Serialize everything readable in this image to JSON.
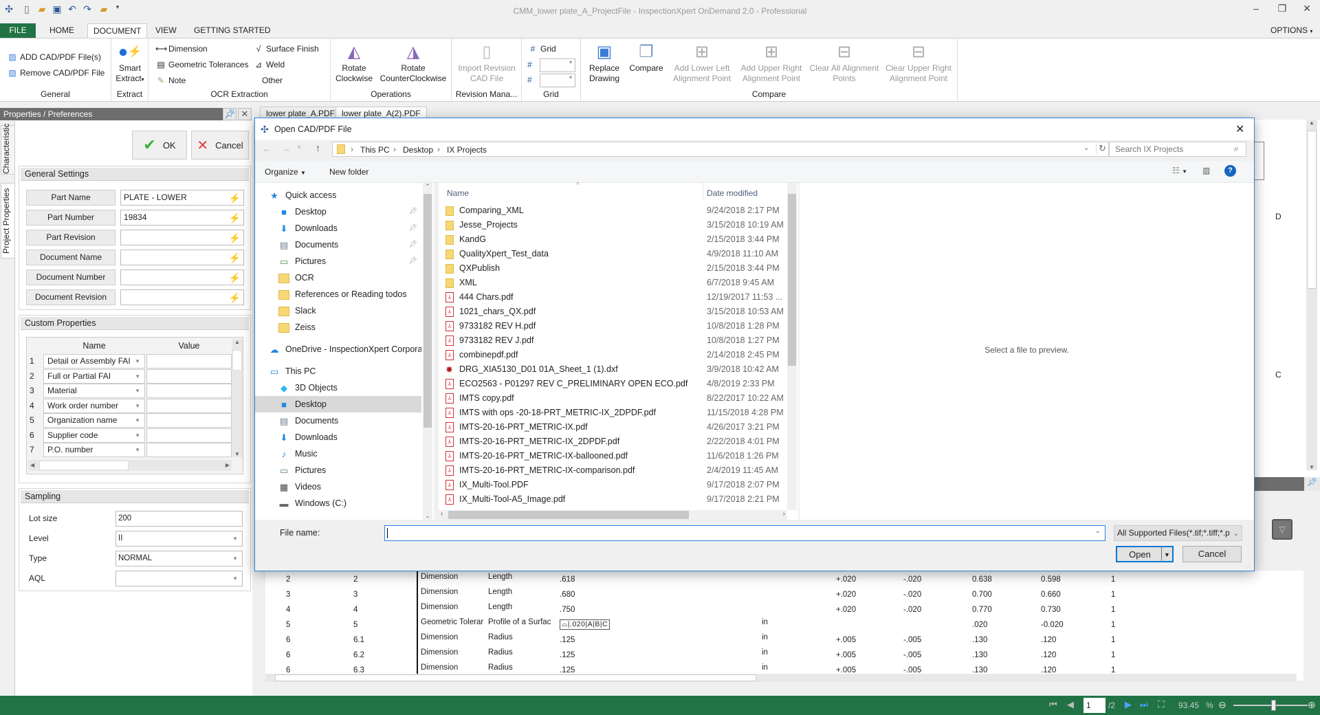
{
  "app": {
    "title": "CMM_lower plate_A_ProjectFile - InspectionXpert OnDemand 2.0 - Professional",
    "options_label": "OPTIONS"
  },
  "ribbon_tabs": [
    "FILE",
    "HOME",
    "DOCUMENT",
    "VIEW",
    "GETTING STARTED"
  ],
  "ribbon": {
    "general": {
      "add": "ADD CAD/PDF File(s)",
      "remove": "Remove CAD/PDF File",
      "label": "General"
    },
    "extract": {
      "smart_1": "Smart",
      "smart_2": "Extract",
      "label": "Extract"
    },
    "ocr": {
      "dimension": "Dimension",
      "geo": "Geometric Tolerances",
      "note": "Note",
      "surface": "Surface Finish",
      "weld": "Weld",
      "other": "Other",
      "label": "OCR Extraction"
    },
    "operations": {
      "cw_1": "Rotate",
      "cw_2": "Clockwise",
      "ccw_1": "Rotate",
      "ccw_2": "CounterClockwise",
      "label": "Operations"
    },
    "revision": {
      "import_1": "Import Revision",
      "import_2": "CAD File",
      "label": "Revision Mana..."
    },
    "grid": {
      "grid": "Grid",
      "label": "Grid"
    },
    "compare": {
      "replace_1": "Replace",
      "replace_2": "Drawing",
      "compare": "Compare",
      "lower_left_1": "Add Lower Left",
      "lower_left_2": "Alignment Point",
      "upper_right_1": "Add Upper Right",
      "upper_right_2": "Alignment Point",
      "clear_all_1": "Clear All Alignment",
      "clear_all_2": "Points",
      "clear_ur_1": "Clear Upper Right",
      "clear_ur_2": "Alignment Point",
      "label": "Compare"
    }
  },
  "left_panel": {
    "title": "Properties / Preferences",
    "vtabs": [
      "Characteristic",
      "Project Properties"
    ],
    "ok": "OK",
    "cancel": "Cancel",
    "general_settings": {
      "title": "General Settings",
      "fields": [
        {
          "label": "Part Name",
          "value": "PLATE - LOWER"
        },
        {
          "label": "Part Number",
          "value": "19834"
        },
        {
          "label": "Part Revision",
          "value": ""
        },
        {
          "label": "Document Name",
          "value": ""
        },
        {
          "label": "Document Number",
          "value": ""
        },
        {
          "label": "Document Revision",
          "value": ""
        }
      ]
    },
    "custom_properties": {
      "title": "Custom Properties",
      "headers": [
        "Name",
        "Value"
      ],
      "rows": [
        {
          "n": "1",
          "name": "Detail or Assembly FAI",
          "value": ""
        },
        {
          "n": "2",
          "name": "Full or Partial FAI",
          "value": ""
        },
        {
          "n": "3",
          "name": "Material",
          "value": ""
        },
        {
          "n": "4",
          "name": "Work order number",
          "value": ""
        },
        {
          "n": "5",
          "name": "Organization name",
          "value": ""
        },
        {
          "n": "6",
          "name": "Supplier code",
          "value": ""
        },
        {
          "n": "7",
          "name": "P.O. number",
          "value": ""
        }
      ]
    },
    "sampling": {
      "title": "Sampling",
      "fields": [
        {
          "label": "Lot size",
          "value": "200",
          "dropdown": false
        },
        {
          "label": "Level",
          "value": "II",
          "dropdown": true
        },
        {
          "label": "Type",
          "value": "NORMAL",
          "dropdown": true
        },
        {
          "label": "AQL",
          "value": "",
          "dropdown": true
        }
      ]
    }
  },
  "doc_tabs": [
    "lower plate_A.PDF",
    "lower plate_A(2).PDF"
  ],
  "drawing_labels": [
    "D",
    "C"
  ],
  "dialog": {
    "title": "Open CAD/PDF File",
    "breadcrumb": [
      "This PC",
      "Desktop",
      "IX Projects"
    ],
    "search_placeholder": "Search IX Projects",
    "organize": "Organize",
    "new_folder": "New folder",
    "col_name": "Name",
    "col_date": "Date modified",
    "preview_text": "Select a file to preview.",
    "file_name_label": "File name:",
    "file_name_value": "",
    "file_type": "All Supported Files(*.tif;*.tiff;*.p",
    "open": "Open",
    "cancel": "Cancel",
    "nav": [
      {
        "label": "Quick access",
        "icon": "star",
        "level": 0
      },
      {
        "label": "Desktop",
        "icon": "desktop",
        "level": 1,
        "pinned": true
      },
      {
        "label": "Downloads",
        "icon": "download",
        "level": 1,
        "pinned": true
      },
      {
        "label": "Documents",
        "icon": "documents",
        "level": 1,
        "pinned": true
      },
      {
        "label": "Pictures",
        "icon": "pictures",
        "level": 1,
        "pinned": true
      },
      {
        "label": "OCR",
        "icon": "folder",
        "level": 1
      },
      {
        "label": "References or Reading todos",
        "icon": "folder",
        "level": 1
      },
      {
        "label": "Slack",
        "icon": "folder",
        "level": 1
      },
      {
        "label": "Zeiss",
        "icon": "folder",
        "level": 1
      },
      {
        "label": "OneDrive - InspectionXpert Corporatio",
        "icon": "cloud",
        "level": 0
      },
      {
        "label": "This PC",
        "icon": "computer",
        "level": 0
      },
      {
        "label": "3D Objects",
        "icon": "cube",
        "level": 1
      },
      {
        "label": "Desktop",
        "icon": "desktop",
        "level": 1,
        "selected": true
      },
      {
        "label": "Documents",
        "icon": "documents",
        "level": 1
      },
      {
        "label": "Downloads",
        "icon": "download",
        "level": 1
      },
      {
        "label": "Music",
        "icon": "music",
        "level": 1
      },
      {
        "label": "Pictures",
        "icon": "pictures",
        "level": 1
      },
      {
        "label": "Videos",
        "icon": "videos",
        "level": 1
      },
      {
        "label": "Windows (C:)",
        "icon": "drive",
        "level": 1
      }
    ],
    "files": [
      {
        "name": "Comparing_XML",
        "date": "9/24/2018 2:17 PM",
        "type": "folder"
      },
      {
        "name": "Jesse_Projects",
        "date": "3/15/2018 10:19 AM",
        "type": "folder"
      },
      {
        "name": "KandG",
        "date": "2/15/2018 3:44 PM",
        "type": "folder"
      },
      {
        "name": "QualityXpert_Test_data",
        "date": "4/9/2018 11:10 AM",
        "type": "folder"
      },
      {
        "name": "QXPublish",
        "date": "2/15/2018 3:44 PM",
        "type": "folder"
      },
      {
        "name": "XML",
        "date": "6/7/2018 9:45 AM",
        "type": "folder"
      },
      {
        "name": "444 Chars.pdf",
        "date": "12/19/2017 11:53 ...",
        "type": "pdf"
      },
      {
        "name": "1021_chars_QX.pdf",
        "date": "3/15/2018 10:53 AM",
        "type": "pdf"
      },
      {
        "name": "9733182 REV H.pdf",
        "date": "10/8/2018 1:28 PM",
        "type": "pdf"
      },
      {
        "name": "9733182 REV J.pdf",
        "date": "10/8/2018 1:27 PM",
        "type": "pdf"
      },
      {
        "name": "combinepdf.pdf",
        "date": "2/14/2018 2:45 PM",
        "type": "pdf"
      },
      {
        "name": "DRG_XIA5130_D01 01A_Sheet_1 (1).dxf",
        "date": "3/9/2018 10:42 AM",
        "type": "dxf"
      },
      {
        "name": "ECO2563 - P01297 REV C_PRELIMINARY OPEN ECO.pdf",
        "date": "4/8/2019 2:33 PM",
        "type": "pdf"
      },
      {
        "name": "IMTS copy.pdf",
        "date": "8/22/2017 10:22 AM",
        "type": "pdf"
      },
      {
        "name": "IMTS with ops -20-18-PRT_METRIC-IX_2DPDF.pdf",
        "date": "11/15/2018 4:28 PM",
        "type": "pdf"
      },
      {
        "name": "IMTS-20-16-PRT_METRIC-IX.pdf",
        "date": "4/26/2017 3:21 PM",
        "type": "pdf"
      },
      {
        "name": "IMTS-20-16-PRT_METRIC-IX_2DPDF.pdf",
        "date": "2/22/2018 4:01 PM",
        "type": "pdf"
      },
      {
        "name": "IMTS-20-16-PRT_METRIC-IX-ballooned.pdf",
        "date": "11/6/2018 1:26 PM",
        "type": "pdf"
      },
      {
        "name": "IMTS-20-16-PRT_METRIC-IX-comparison.pdf",
        "date": "2/4/2019 11:45 AM",
        "type": "pdf"
      },
      {
        "name": "IX_Multi-Tool.PDF",
        "date": "9/17/2018 2:07 PM",
        "type": "pdf"
      },
      {
        "name": "IX_Multi-Tool-A5_Image.pdf",
        "date": "9/17/2018 2:21 PM",
        "type": "pdf"
      }
    ]
  },
  "char_table": {
    "rows": [
      [
        "2",
        "2",
        "Dimension",
        "Length",
        ".618",
        "",
        "+.020",
        "-.020",
        "0.638",
        "0.598",
        "1"
      ],
      [
        "3",
        "3",
        "Dimension",
        "Length",
        ".680",
        "",
        "+.020",
        "-.020",
        "0.700",
        "0.660",
        "1"
      ],
      [
        "4",
        "4",
        "Dimension",
        "Length",
        ".750",
        "",
        "+.020",
        "-.020",
        "0.770",
        "0.730",
        "1"
      ],
      [
        "5",
        "5",
        "Geometric Tolerar",
        "Profile of a Surfac",
        "⌓|.020|A|B|C",
        "in",
        "",
        "",
        ".020",
        "-0.020",
        "1"
      ],
      [
        "6",
        "6.1",
        "Dimension",
        "Radius",
        ".125",
        "in",
        "+.005",
        "-.005",
        ".130",
        ".120",
        "1"
      ],
      [
        "6",
        "6.2",
        "Dimension",
        "Radius",
        ".125",
        "in",
        "+.005",
        "-.005",
        ".130",
        ".120",
        "1"
      ],
      [
        "6",
        "6.3",
        "Dimension",
        "Radius",
        ".125",
        "in",
        "+.005",
        "-.005",
        ".130",
        ".120",
        "1"
      ]
    ]
  },
  "status": {
    "page": "1",
    "page_total": "/2",
    "zoom": "93.45",
    "zoom_unit": "%",
    "zoom_slider_fraction": 0.55
  },
  "colors": {
    "brand_green": "#217346",
    "accent_blue": "#2b83d6"
  }
}
